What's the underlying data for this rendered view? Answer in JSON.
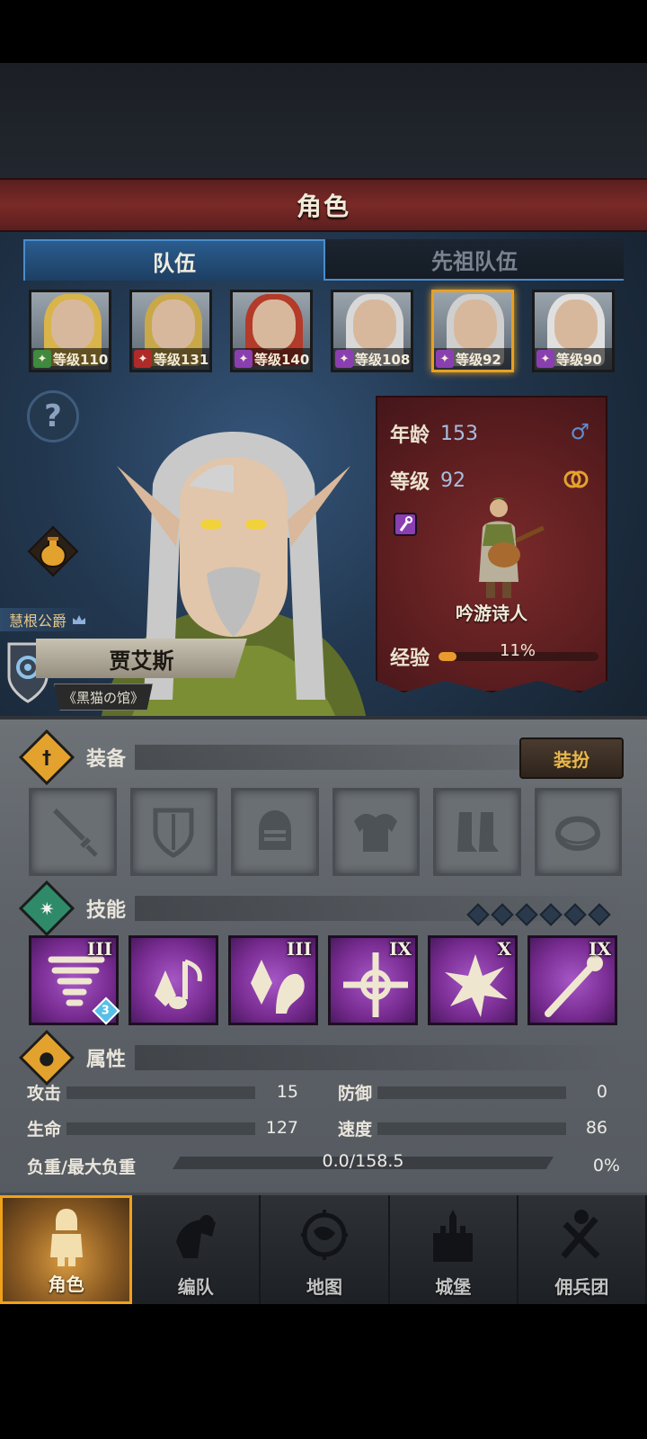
{
  "header": {
    "title": "角色"
  },
  "tabs": [
    {
      "label": "队伍",
      "active": true
    },
    {
      "label": "先祖队伍",
      "active": false
    }
  ],
  "heroes": [
    {
      "level_text": "等级110",
      "class_icon": "bow-icon",
      "class_color": "#3f8a3f",
      "hair": "#d9b44a"
    },
    {
      "level_text": "等级131",
      "class_icon": "horse-icon",
      "class_color": "#b02a2a",
      "hair": "#c9a84a"
    },
    {
      "level_text": "等级140",
      "class_icon": "staff-icon",
      "class_color": "#8a3fb0",
      "hair": "#b43a2a"
    },
    {
      "level_text": "等级108",
      "class_icon": "staff-icon",
      "class_color": "#8a3fb0",
      "hair": "#d8d8d8"
    },
    {
      "level_text": "等级92",
      "class_icon": "staff-icon",
      "class_color": "#8a3fb0",
      "hair": "#cfcfcf",
      "selected": true
    },
    {
      "level_text": "等级90",
      "class_icon": "staff-icon",
      "class_color": "#8a3fb0",
      "hair": "#e0e0e0"
    }
  ],
  "character": {
    "title": "慧根公爵",
    "name": "贾艾斯",
    "guild": "《黑猫の馆》"
  },
  "info": {
    "age_label": "年龄",
    "age_value": "153",
    "gender_symbol": "♂",
    "level_label": "等级",
    "level_value": "92",
    "class_name": "吟游诗人",
    "exp_label": "经验",
    "exp_percent_text": "11%",
    "exp_fraction": 0.11
  },
  "equipment": {
    "title": "装备",
    "dress_button": "装扮",
    "slots": [
      "sword-slot-icon",
      "shield-slot-icon",
      "helmet-slot-icon",
      "armor-slot-icon",
      "boots-slot-icon",
      "ring-slot-icon"
    ]
  },
  "skills": {
    "title": "技能",
    "points_total": 6,
    "items": [
      {
        "icon": "tornado-icon",
        "rank": "III",
        "sub_badge": "3"
      },
      {
        "icon": "music-note-icon",
        "rank": ""
      },
      {
        "icon": "crystal-flute-icon",
        "rank": "III"
      },
      {
        "icon": "target-cross-icon",
        "rank": "IX"
      },
      {
        "icon": "burst-icon",
        "rank": "X"
      },
      {
        "icon": "torch-staff-icon",
        "rank": "IX"
      }
    ]
  },
  "attributes": {
    "title": "属性",
    "attack_label": "攻击",
    "attack_value": "15",
    "defense_label": "防御",
    "defense_value": "0",
    "hp_label": "生命",
    "hp_value": "127",
    "speed_label": "速度",
    "speed_value": "86",
    "load_label": "负重/最大负重",
    "load_value": "0.0/158.5",
    "load_percent": "0%"
  },
  "nav": [
    {
      "label": "角色",
      "icon": "knight-icon",
      "active": true
    },
    {
      "label": "编队",
      "icon": "formation-icon",
      "active": false
    },
    {
      "label": "地图",
      "icon": "compass-map-icon",
      "active": false
    },
    {
      "label": "城堡",
      "icon": "castle-icon",
      "active": false
    },
    {
      "label": "佣兵团",
      "icon": "mercenary-icon",
      "active": false
    }
  ]
}
